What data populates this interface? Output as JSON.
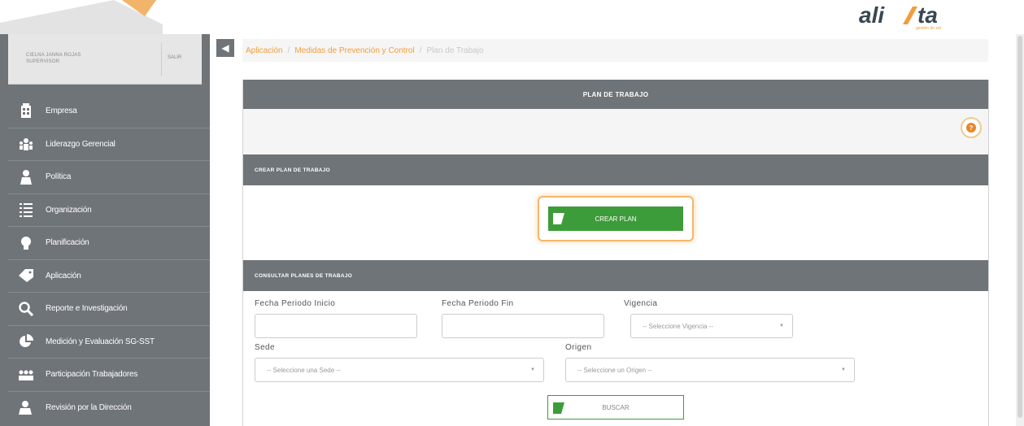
{
  "header": {
    "logo_text": "alissta",
    "logo_tagline": "gestión de sst"
  },
  "user": {
    "name": "CIELNA JANNA ROJAS",
    "role": "SUPERVISOR",
    "logout_label": "SALIR"
  },
  "sidebar": {
    "items": [
      {
        "label": "Empresa",
        "icon": "building-icon"
      },
      {
        "label": "Liderazgo Gerencial",
        "icon": "leadership-icon"
      },
      {
        "label": "Política",
        "icon": "person-icon"
      },
      {
        "label": "Organización",
        "icon": "list-icon"
      },
      {
        "label": "Planificación",
        "icon": "lightbulb-icon"
      },
      {
        "label": "Aplicación",
        "icon": "tag-icon"
      },
      {
        "label": "Reporte e Investigación",
        "icon": "magnifier-icon"
      },
      {
        "label": "Medición y Evaluación SG-SST",
        "icon": "pie-chart-icon"
      },
      {
        "label": "Participación Trabajadores",
        "icon": "group-icon"
      },
      {
        "label": "Revisión por la Dirección",
        "icon": "manager-icon"
      }
    ]
  },
  "breadcrumb": {
    "items": [
      "Aplicación",
      "Medidas de Prevención y Control"
    ],
    "current": "Plan de Trabajo"
  },
  "panel": {
    "title": "PLAN DE TRABAJO",
    "help_label": "?",
    "crear_section": "CREAR PLAN DE TRABAJO",
    "crear_button": "CREAR PLAN",
    "consultar_section": "CONSULTAR PLANES DE TRABAJO"
  },
  "filters": {
    "fecha_inicio_label": "Fecha Periodo Inicio",
    "fecha_fin_label": "Fecha Periodo Fin",
    "vigencia_label": "Vigencia",
    "vigencia_value": "-- Seleccione Vigencia --",
    "sede_label": "Sede",
    "sede_value": "-- Seleccione una Sede --",
    "origen_label": "Origen",
    "origen_value": "-- Seleccione un Origen --",
    "buscar_button": "BUSCAR"
  },
  "colors": {
    "sidebar": "#6f7479",
    "accent": "#f39c3a",
    "green": "#3d9c3a"
  }
}
